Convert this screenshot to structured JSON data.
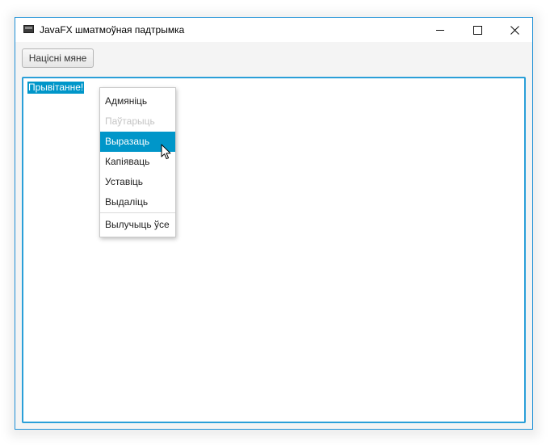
{
  "window": {
    "title": "JavaFX шматмоўная падтрымка",
    "controls": {
      "minimize": "minimize-icon",
      "maximize": "maximize-icon",
      "close": "close-icon"
    }
  },
  "toolbar": {
    "button_label": "Націсні мяне"
  },
  "editor": {
    "selected_text": "Прывітанне!"
  },
  "context_menu": {
    "items": [
      {
        "label": "Адмяніць",
        "state": "enabled"
      },
      {
        "label": "Паўтарыць",
        "state": "disabled"
      },
      {
        "label": "Выразаць",
        "state": "highlighted"
      },
      {
        "label": "Капіяваць",
        "state": "enabled"
      },
      {
        "label": "Уставіць",
        "state": "enabled"
      },
      {
        "label": "Выдаліць",
        "state": "enabled"
      }
    ],
    "select_all": "Вылучыць ўсе"
  },
  "colors": {
    "accent": "#0096c9",
    "focus_border": "#2a9fd8",
    "window_border": "#1e90d6"
  }
}
